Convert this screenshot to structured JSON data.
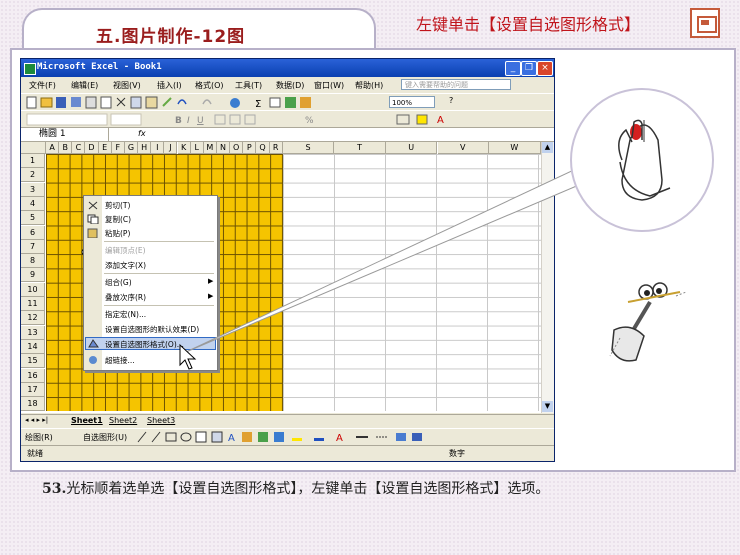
{
  "slide": {
    "title": "五.图片制作-12图",
    "instruction": "左键单击【设置自选图形格式】",
    "caption_number": "53.",
    "caption_text": "光标顺着选单选【设置自选图形格式】，左键单击【设置自选图形格式】选项。"
  },
  "window": {
    "title": "Microsoft Excel - Book1",
    "buttons": [
      "_",
      "❐",
      "×"
    ]
  },
  "menubar": {
    "items": [
      "文件(F)",
      "编辑(E)",
      "视图(V)",
      "插入(I)",
      "格式(O)",
      "工具(T)",
      "数据(D)",
      "窗口(W)",
      "帮助(H)"
    ],
    "help_placeholder": "键入需要帮助的问题"
  },
  "toolbar": {
    "zoom": "100%"
  },
  "formulabar": {
    "name_box": "椭圆 1",
    "fx": "fx"
  },
  "grid": {
    "columns": [
      "A",
      "B",
      "C",
      "D",
      "E",
      "F",
      "G",
      "H",
      "I",
      "J",
      "K",
      "L",
      "M",
      "N",
      "O",
      "P",
      "Q",
      "R",
      "S",
      "T",
      "U",
      "V",
      "W"
    ],
    "rows": [
      "1",
      "2",
      "3",
      "4",
      "5",
      "6",
      "7",
      "8",
      "9",
      "10",
      "11",
      "12",
      "13",
      "14",
      "15",
      "16",
      "17",
      "18"
    ]
  },
  "context_menu": {
    "items": [
      {
        "label": "剪切(T)",
        "disabled": false
      },
      {
        "label": "复制(C)",
        "disabled": false
      },
      {
        "label": "粘贴(P)",
        "disabled": false
      },
      {
        "label": "编辑顶点(E)",
        "disabled": true
      },
      {
        "label": "添加文字(X)",
        "disabled": false
      },
      {
        "label": "组合(G)",
        "disabled": false,
        "submenu": true
      },
      {
        "label": "叠放次序(R)",
        "disabled": false,
        "submenu": true
      },
      {
        "label": "指定宏(N)...",
        "disabled": false
      },
      {
        "label": "设置自选图形的默认效果(D)",
        "disabled": false
      },
      {
        "label": "设置自选图形格式(O)...",
        "disabled": false,
        "highlighted": true
      },
      {
        "label": "超链接...",
        "disabled": false
      }
    ]
  },
  "sheet_tabs": [
    "Sheet1",
    "Sheet2",
    "Sheet3"
  ],
  "drawing_toolbar": {
    "draw_label": "绘图(R)",
    "autoshape_label": "自选图形(U)"
  },
  "statusbar": {
    "left": "就绪",
    "right": "数字"
  },
  "colors": {
    "accent_red": "#c0141b",
    "title_red": "#9a1d1d",
    "grid_yellow": "#f5c400",
    "xp_blue": "#0a3fb0"
  }
}
